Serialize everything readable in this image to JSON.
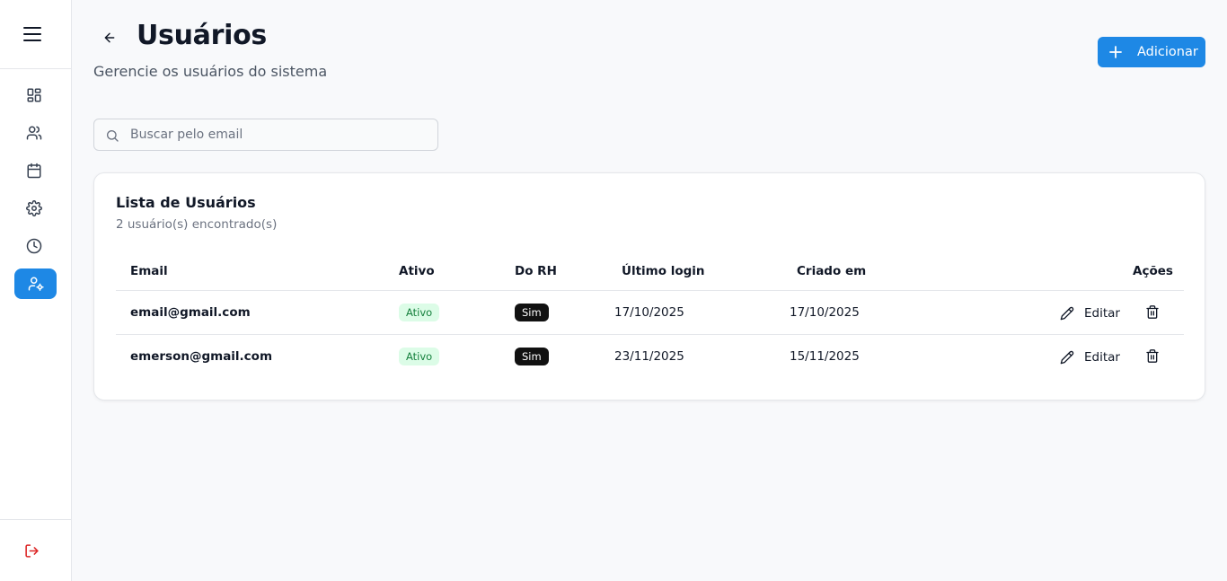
{
  "colors": {
    "accent": "#1e88e5",
    "logout": "#dc2626",
    "active_badge_bg": "#dcfce7",
    "active_badge_text": "#15803d",
    "sim_badge_bg": "#111111"
  },
  "sidebar": {
    "menu_icon": "hamburger-menu-icon",
    "items": [
      {
        "icon": "dashboard-grid-icon",
        "active": false
      },
      {
        "icon": "users-icon",
        "active": false
      },
      {
        "icon": "calendar-icon",
        "active": false
      },
      {
        "icon": "gear-icon",
        "active": false
      },
      {
        "icon": "clock-icon",
        "active": false
      },
      {
        "icon": "user-settings-icon",
        "active": true
      }
    ],
    "logout_icon": "logout-icon"
  },
  "header": {
    "title": "Usuários",
    "subtitle": "Gerencie os usuários do sistema",
    "add_label": "Adicionar"
  },
  "search": {
    "placeholder": "Buscar pelo email",
    "value": ""
  },
  "card": {
    "title": "Lista de Usuários",
    "count": "2 usuário(s) encontrado(s)"
  },
  "table": {
    "headers": {
      "email": "Email",
      "ativo": "Ativo",
      "do_rh": "Do RH",
      "ultimo_login": "Último login",
      "criado_em": "Criado em",
      "acoes": "Ações"
    },
    "rows": [
      {
        "email": "email@gmail.com",
        "ativo": "Ativo",
        "do_rh": "Sim",
        "ultimo_login": "17/10/2025",
        "criado_em": "17/10/2025",
        "edit": "Editar"
      },
      {
        "email": "emerson@gmail.com",
        "ativo": "Ativo",
        "do_rh": "Sim",
        "ultimo_login": "23/11/2025",
        "criado_em": "15/11/2025",
        "edit": "Editar"
      }
    ]
  }
}
